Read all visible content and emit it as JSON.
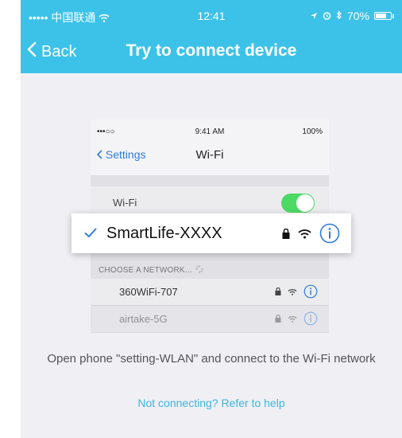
{
  "status_bar": {
    "carrier": "••••• 中国联通",
    "time": "12:41",
    "battery": "70%"
  },
  "nav": {
    "back_label": "Back",
    "title": "Try to connect device"
  },
  "illustration": {
    "status_carrier": "•••○○",
    "status_time": "9:41 AM",
    "status_battery": "100%",
    "back_label": "Settings",
    "title": "Wi-Fi",
    "wifi_label": "Wi-Fi",
    "wifi_toggle_on": true,
    "highlighted_network": "SmartLife-XXXX",
    "section_header": "CHOOSE A NETWORK...",
    "networks": [
      "360WiFi-707",
      "airtake-5G"
    ]
  },
  "instruction": "Open phone \"setting-WLAN\" and connect to the Wi-Fi network",
  "help_link": "Not connecting? Refer to help",
  "colors": {
    "header": "#3cc2e8",
    "link": "#3cb6e0",
    "ios_blue": "#2f7be0",
    "toggle_on": "#4cd964"
  }
}
